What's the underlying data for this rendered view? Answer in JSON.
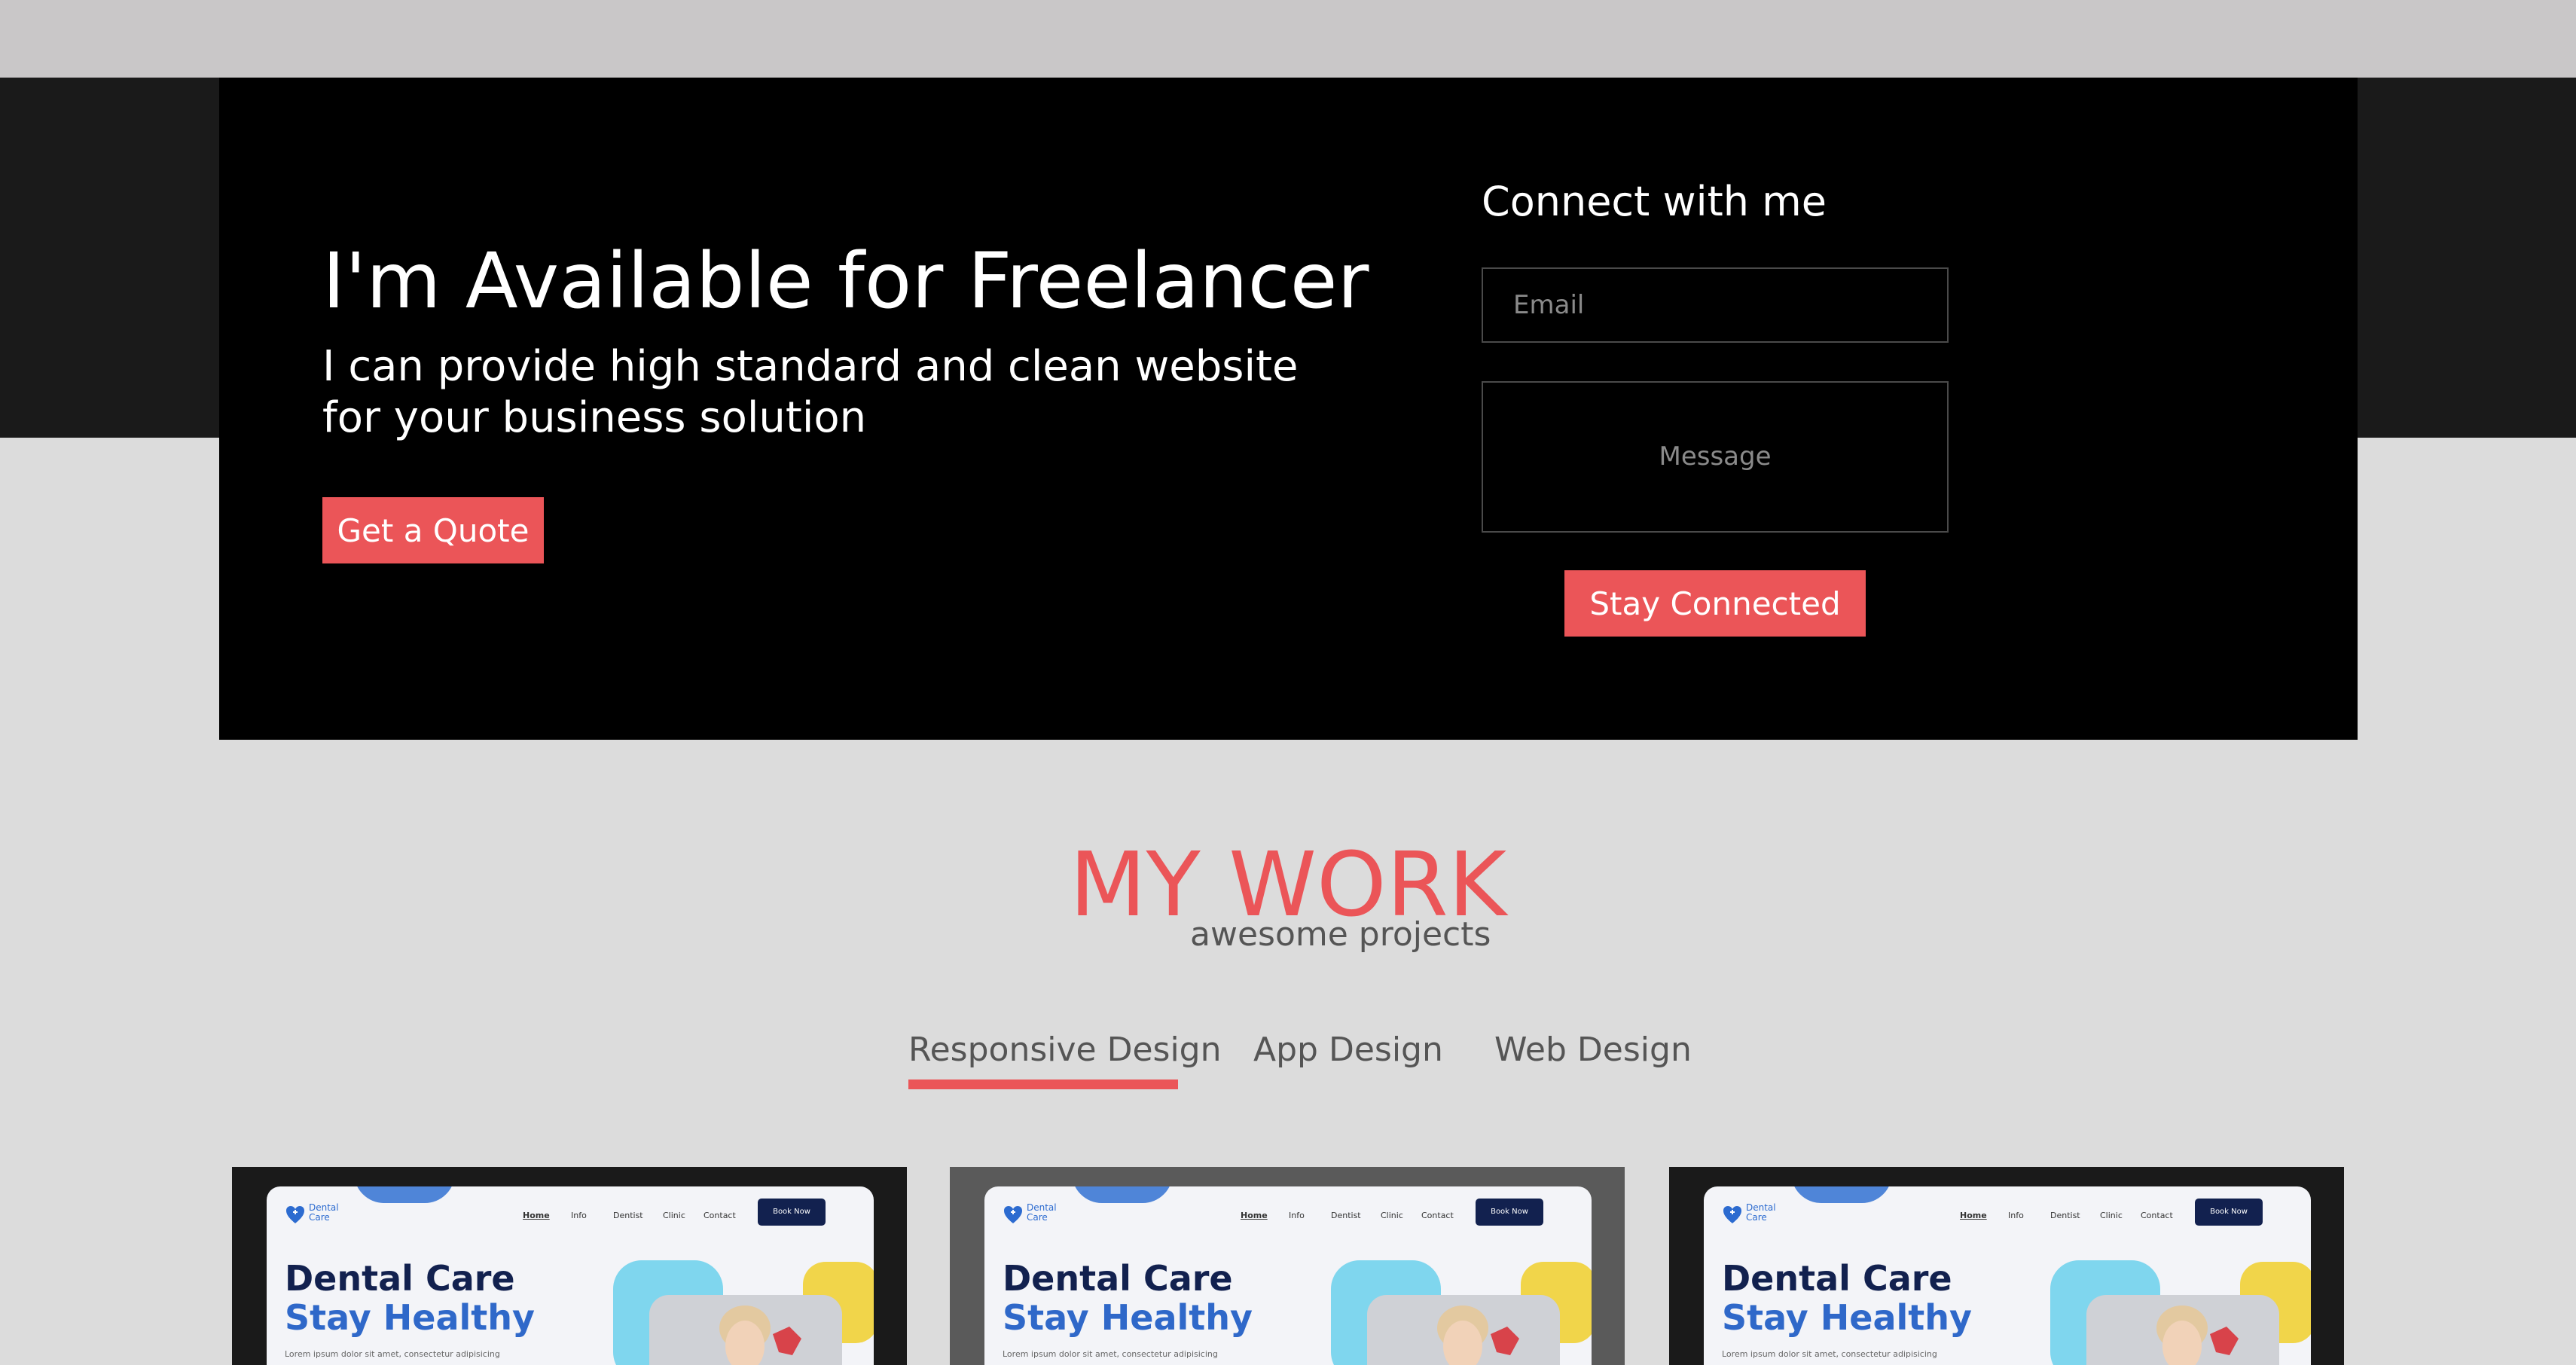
{
  "hero": {
    "title": "I'm Available for Freelancer",
    "subtitle": "I can provide high standard and clean website for your business solution",
    "quote_button": "Get a Quote"
  },
  "contact": {
    "title": "Connect with me",
    "email_placeholder": "Email",
    "message_placeholder": "Message",
    "submit_button": "Stay Connected"
  },
  "work": {
    "title": "MY WORK",
    "subtitle": "awesome projects",
    "tabs": [
      {
        "label": "Responsive Design",
        "active": true
      },
      {
        "label": "App Design",
        "active": false
      },
      {
        "label": "Web Design",
        "active": false
      }
    ],
    "cards": [
      {
        "brand": "Dental Care",
        "nav": [
          "Home",
          "Info",
          "Dentist",
          "Clinic",
          "Contact"
        ],
        "book_button": "Book Now",
        "heading_line1": "Dental Care",
        "heading_line2": "Stay Healthy",
        "body_text": "Lorem ipsum dolor sit amet, consectetur adipisicing"
      },
      {
        "brand": "Dental Care",
        "nav": [
          "Home",
          "Info",
          "Dentist",
          "Clinic",
          "Contact"
        ],
        "book_button": "Book Now",
        "heading_line1": "Dental Care",
        "heading_line2": "Stay Healthy",
        "body_text": "Lorem ipsum dolor sit amet, consectetur adipisicing"
      },
      {
        "brand": "Dental Care",
        "nav": [
          "Home",
          "Info",
          "Dentist",
          "Clinic",
          "Contact"
        ],
        "book_button": "Book Now",
        "heading_line1": "Dental Care",
        "heading_line2": "Stay Healthy",
        "body_text": "Lorem ipsum dolor sit amet, consectetur adipisicing"
      }
    ]
  },
  "colors": {
    "accent": "#eb5558",
    "hero_bg": "#000000",
    "page_bg": "#dcdcdc",
    "dark_band": "#1a1a1a",
    "top_bar": "#c9c7c8",
    "mock_navy": "#12214f",
    "mock_blue": "#2f68c9"
  },
  "icons": {
    "card_logo": "tooth-heart-icon",
    "card_image": "person-photo"
  }
}
